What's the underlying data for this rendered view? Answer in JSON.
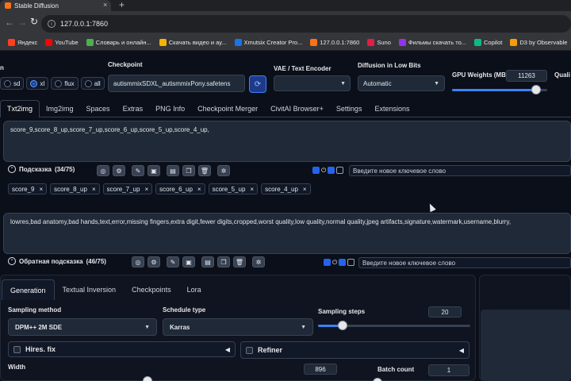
{
  "browser": {
    "tab_title": "Stable Diffusion",
    "tab_close": "×",
    "new_tab": "+",
    "url": "127.0.0.1:7860",
    "bookmarks": [
      {
        "label": "Яндекс",
        "color": "#fc3f1d"
      },
      {
        "label": "YouTube",
        "color": "#ff0000"
      },
      {
        "label": "Словарь и онлайн...",
        "color": "#4caf50"
      },
      {
        "label": "Скачать видео и ау...",
        "color": "#f4b400"
      },
      {
        "label": "Xmutsix Creator Pro...",
        "color": "#1a73e8"
      },
      {
        "label": "127.0.0.1:7860",
        "color": "#f97316"
      },
      {
        "label": "Suno",
        "color": "#e11d48"
      },
      {
        "label": "Фильмы скачать то...",
        "color": "#9333ea"
      },
      {
        "label": "Copilot",
        "color": "#10b981"
      },
      {
        "label": "D3 by Observable",
        "color": "#f59e0b"
      }
    ]
  },
  "top": {
    "model_type_options": [
      {
        "label": "sd",
        "selected": false
      },
      {
        "label": "xl",
        "selected": true
      },
      {
        "label": "flux",
        "selected": false
      },
      {
        "label": "all",
        "selected": false
      }
    ],
    "checkpoint_label": "Checkpoint",
    "checkpoint_value": "autismmixSDXL_autismmixPony.safetens",
    "vae_label": "VAE / Text Encoder",
    "vae_value": "",
    "diffusion_label": "Diffusion in Low Bits",
    "diffusion_value": "Automatic",
    "gpu_label": "GPU Weights (MB)",
    "gpu_value": "11263",
    "gpu_fraction": 0.88,
    "quality_label": "Quali"
  },
  "main_tabs": [
    {
      "label": "Txt2img",
      "active": true
    },
    {
      "label": "Img2img",
      "active": false
    },
    {
      "label": "Spaces",
      "active": false
    },
    {
      "label": "Extras",
      "active": false
    },
    {
      "label": "PNG Info",
      "active": false
    },
    {
      "label": "Checkpoint Merger",
      "active": false
    },
    {
      "label": "CivitAI Browser+",
      "active": false
    },
    {
      "label": "Settings",
      "active": false
    },
    {
      "label": "Extensions",
      "active": false
    }
  ],
  "prompt": {
    "text": "score_9,score_8_up,score_7_up,score_6_up,score_5_up,score_4_up,",
    "helper_label": "Подсказка",
    "helper_count": "(34/75)",
    "keyword_placeholder": "Введите новое ключевое слово",
    "tags": [
      "score_9",
      "score_8_up",
      "score_7_up",
      "score_6_up",
      "score_5_up",
      "score_4_up"
    ]
  },
  "negative": {
    "text": "lowres,bad anatomy,bad hands,text,error,missing fingers,extra digit,fewer digits,cropped,worst quality,low quality,normal quality,jpeg artifacts,signature,watermark,username,blurry,",
    "helper_label": "Обратная подсказка",
    "helper_count": "(46/75)",
    "keyword_placeholder": "Введите новое ключевое слово"
  },
  "gen_tabs": [
    {
      "label": "Generation",
      "active": true
    },
    {
      "label": "Textual Inversion",
      "active": false
    },
    {
      "label": "Checkpoints",
      "active": false
    },
    {
      "label": "Lora",
      "active": false
    }
  ],
  "generation": {
    "sampling_method_label": "Sampling method",
    "sampling_method_value": "DPM++ 2M SDE",
    "schedule_label": "Schedule type",
    "schedule_value": "Karras",
    "steps_label": "Sampling steps",
    "steps_value": "20",
    "steps_fraction": 0.16,
    "hires_label": "Hires. fix",
    "refiner_label": "Refiner",
    "width_label": "Width",
    "width_value": "896",
    "batch_count_label": "Batch count",
    "batch_count_value": "1"
  },
  "icons": {
    "prompt_tools": [
      "globe-icon",
      "gear-icon",
      "edit-icon",
      "bookmark-icon",
      "image-icon",
      "copy-icon",
      "trash-icon",
      "settings-icon"
    ]
  }
}
